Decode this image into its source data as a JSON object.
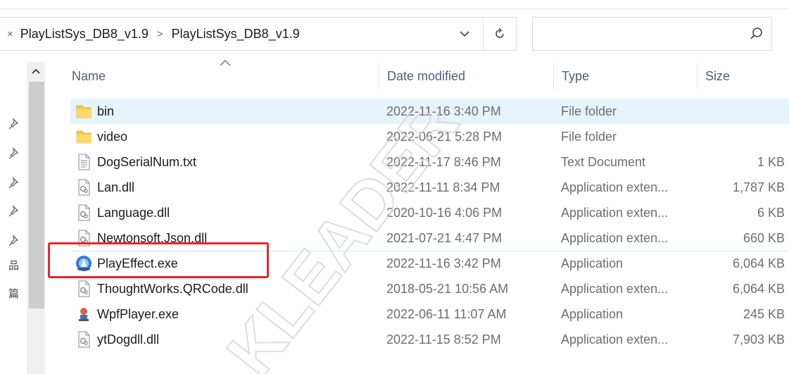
{
  "breadcrumb": {
    "lead": "×",
    "items": [
      "PlayListSys_DB8_v1.9",
      "PlayListSys_DB8_v1.9"
    ],
    "separator": ">"
  },
  "search": {
    "placeholder": ""
  },
  "columns": {
    "name": "Name",
    "date": "Date modified",
    "type": "Type",
    "size": "Size"
  },
  "nav_glyphs": [
    "品",
    "篇"
  ],
  "files": [
    {
      "name": "bin",
      "date": "2022-11-16 3:40 PM",
      "type": "File folder",
      "size": "",
      "icon": "folder-icon",
      "selected": true
    },
    {
      "name": "video",
      "date": "2022-06-21 5:28 PM",
      "type": "File folder",
      "size": "",
      "icon": "folder-icon",
      "selected": false
    },
    {
      "name": "DogSerialNum.txt",
      "date": "2022-11-17 8:46 PM",
      "type": "Text Document",
      "size": "1 KB",
      "icon": "text-file-icon",
      "selected": false
    },
    {
      "name": "Lan.dll",
      "date": "2022-11-11 8:34 PM",
      "type": "Application exten...",
      "size": "1,787 KB",
      "icon": "dll-file-icon",
      "selected": false
    },
    {
      "name": "Language.dll",
      "date": "2020-10-16 4:06 PM",
      "type": "Application exten...",
      "size": "6 KB",
      "icon": "dll-file-icon",
      "selected": false
    },
    {
      "name": "Newtonsoft.Json.dll",
      "date": "2021-07-21 4:47 PM",
      "type": "Application exten...",
      "size": "660 KB",
      "icon": "dll-file-icon",
      "selected": false
    },
    {
      "name": "PlayEffect.exe",
      "date": "2022-11-16 3:42 PM",
      "type": "Application",
      "size": "6,064 KB",
      "icon": "playeffect-app-icon",
      "selected": false
    },
    {
      "name": "ThoughtWorks.QRCode.dll",
      "date": "2018-05-21 10:56 AM",
      "type": "Application exten...",
      "size": "6,064 KB",
      "icon": "dll-file-icon",
      "selected": false
    },
    {
      "name": "WpfPlayer.exe",
      "date": "2022-06-11 11:07 AM",
      "type": "Application",
      "size": "245 KB",
      "icon": "wpfplayer-app-icon",
      "selected": false
    },
    {
      "name": "ytDogdll.dll",
      "date": "2022-11-15 8:52 PM",
      "type": "Application exten...",
      "size": "7,903 KB",
      "icon": "dll-file-icon",
      "selected": false
    }
  ],
  "watermark": {
    "text": "KLEADER"
  },
  "colors": {
    "highlight": "#e8262a",
    "selection": "#e5f3fb",
    "folder": "#f6c94e"
  }
}
